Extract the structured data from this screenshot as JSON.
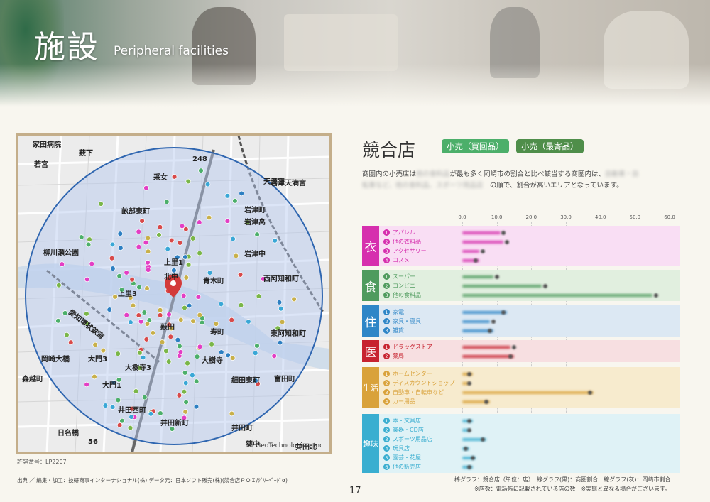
{
  "header": {
    "title_kanji": "施設",
    "title_en": "Peripheral facilities"
  },
  "map": {
    "labels": [
      "家田病院",
      "薮下",
      "若宮",
      "采女",
      "天満宮",
      "岩津天満宮",
      "畝部東町",
      "岩津町",
      "岩津高",
      "岩津中",
      "柳川瀬公園",
      "上里1",
      "北中",
      "青木町",
      "西阿知和町",
      "上里3",
      "愛知環状鉄道",
      "薮田",
      "寿町",
      "東阿知和町",
      "大樹寺",
      "岡崎大橋",
      "大門3",
      "大樹寺3",
      "森越町",
      "大門1",
      "細田東町",
      "富田町",
      "井田西町",
      "井田新町",
      "井田町",
      "日名橋",
      "葵中",
      "井田北",
      "248",
      "56"
    ],
    "copyright": "© GeoTechnologies, Inc.",
    "permit": "許諾番号：LP2207",
    "source": "出典 ／ 編集・加工：技研商事インターナショナル(株) データ元：日本ソフト販売(株)(競合店ＰＯＩ/ｸﾞﾘｰﾍﾞｰｼﾞα)"
  },
  "competitors": {
    "title": "競合店",
    "badge_buy": "小売（買回品）",
    "badge_near": "小売（最寄品）",
    "desc_line1_a": "商圏内の小売店は",
    "desc_line1_blur": "他の食料品",
    "desc_line1_b": "が最も多く岡崎市の割合と比べ該当する商圏内は、",
    "desc_line1_blur2": "自動車・自",
    "desc_line2_blur": "転車など、他の食料品、スポーツ用品店",
    "desc_line2_b": "の順で、割合が高いエリアとなっています。"
  },
  "chart_data": {
    "type": "bar",
    "axis_ticks": [
      "0.0",
      "10.0",
      "20.0",
      "30.0",
      "40.0",
      "50.0",
      "60.0"
    ],
    "xlim": [
      0,
      60
    ],
    "groups": [
      {
        "name": "衣",
        "color": "#d62fae",
        "bg": "#f9def4",
        "items": [
          {
            "label": "アパレル",
            "value": 11,
            "line": 12
          },
          {
            "label": "他の衣料品",
            "value": 12,
            "line": 13
          },
          {
            "label": "アクセサリー",
            "value": 5,
            "line": 6
          },
          {
            "label": "コスメ",
            "value": 5,
            "line": 4
          }
        ]
      },
      {
        "name": "食",
        "color": "#4f9b5e",
        "bg": "#e1efdf",
        "items": [
          {
            "label": "スーパー",
            "value": 9,
            "line": 10
          },
          {
            "label": "コンビニ",
            "value": 23,
            "line": 24
          },
          {
            "label": "他の食料品",
            "value": 55,
            "line": 56
          }
        ]
      },
      {
        "name": "住",
        "color": "#2e86c7",
        "bg": "#dce8f3",
        "items": [
          {
            "label": "家電",
            "value": 13,
            "line": 12
          },
          {
            "label": "家具・寝具",
            "value": 8,
            "line": 9
          },
          {
            "label": "雑貨",
            "value": 9,
            "line": 8
          }
        ]
      },
      {
        "name": "医",
        "color": "#c72330",
        "bg": "#f7dfe1",
        "items": [
          {
            "label": "ドラッグストア",
            "value": 14,
            "line": 15
          },
          {
            "label": "薬局",
            "value": 15,
            "line": 14
          }
        ]
      },
      {
        "name": "生活",
        "color": "#d9a23a",
        "bg": "#f7ebce",
        "items": [
          {
            "label": "ホームセンター",
            "value": 3,
            "line": 2
          },
          {
            "label": "ディスカウントショップ",
            "value": 2,
            "line": 2
          },
          {
            "label": "自動車・自転車など",
            "value": 38,
            "line": 37
          },
          {
            "label": "カー用品",
            "value": 8,
            "line": 7
          }
        ]
      },
      {
        "name": "趣味",
        "color": "#3aaed0",
        "bg": "#dff2f6",
        "items": [
          {
            "label": "本・文具店",
            "value": 3,
            "line": 2
          },
          {
            "label": "楽器・CD店",
            "value": 2,
            "line": 2
          },
          {
            "label": "スポーツ用品店",
            "value": 7,
            "line": 6
          },
          {
            "label": "玩具店",
            "value": 2,
            "line": 1
          },
          {
            "label": "園芸・花屋",
            "value": 4,
            "line": 3
          },
          {
            "label": "他の販売店",
            "value": 3,
            "line": 2
          }
        ]
      }
    ]
  },
  "legend": {
    "line1": "棒グラフ：競合店（単位：店）　線グラフ(黒)：商圏割合　線グラフ(灰)：岡崎市割合",
    "line2": "※店数：電話帳に記載されている店の数　※実態と異なる場合がございます。"
  },
  "page_number": "17"
}
